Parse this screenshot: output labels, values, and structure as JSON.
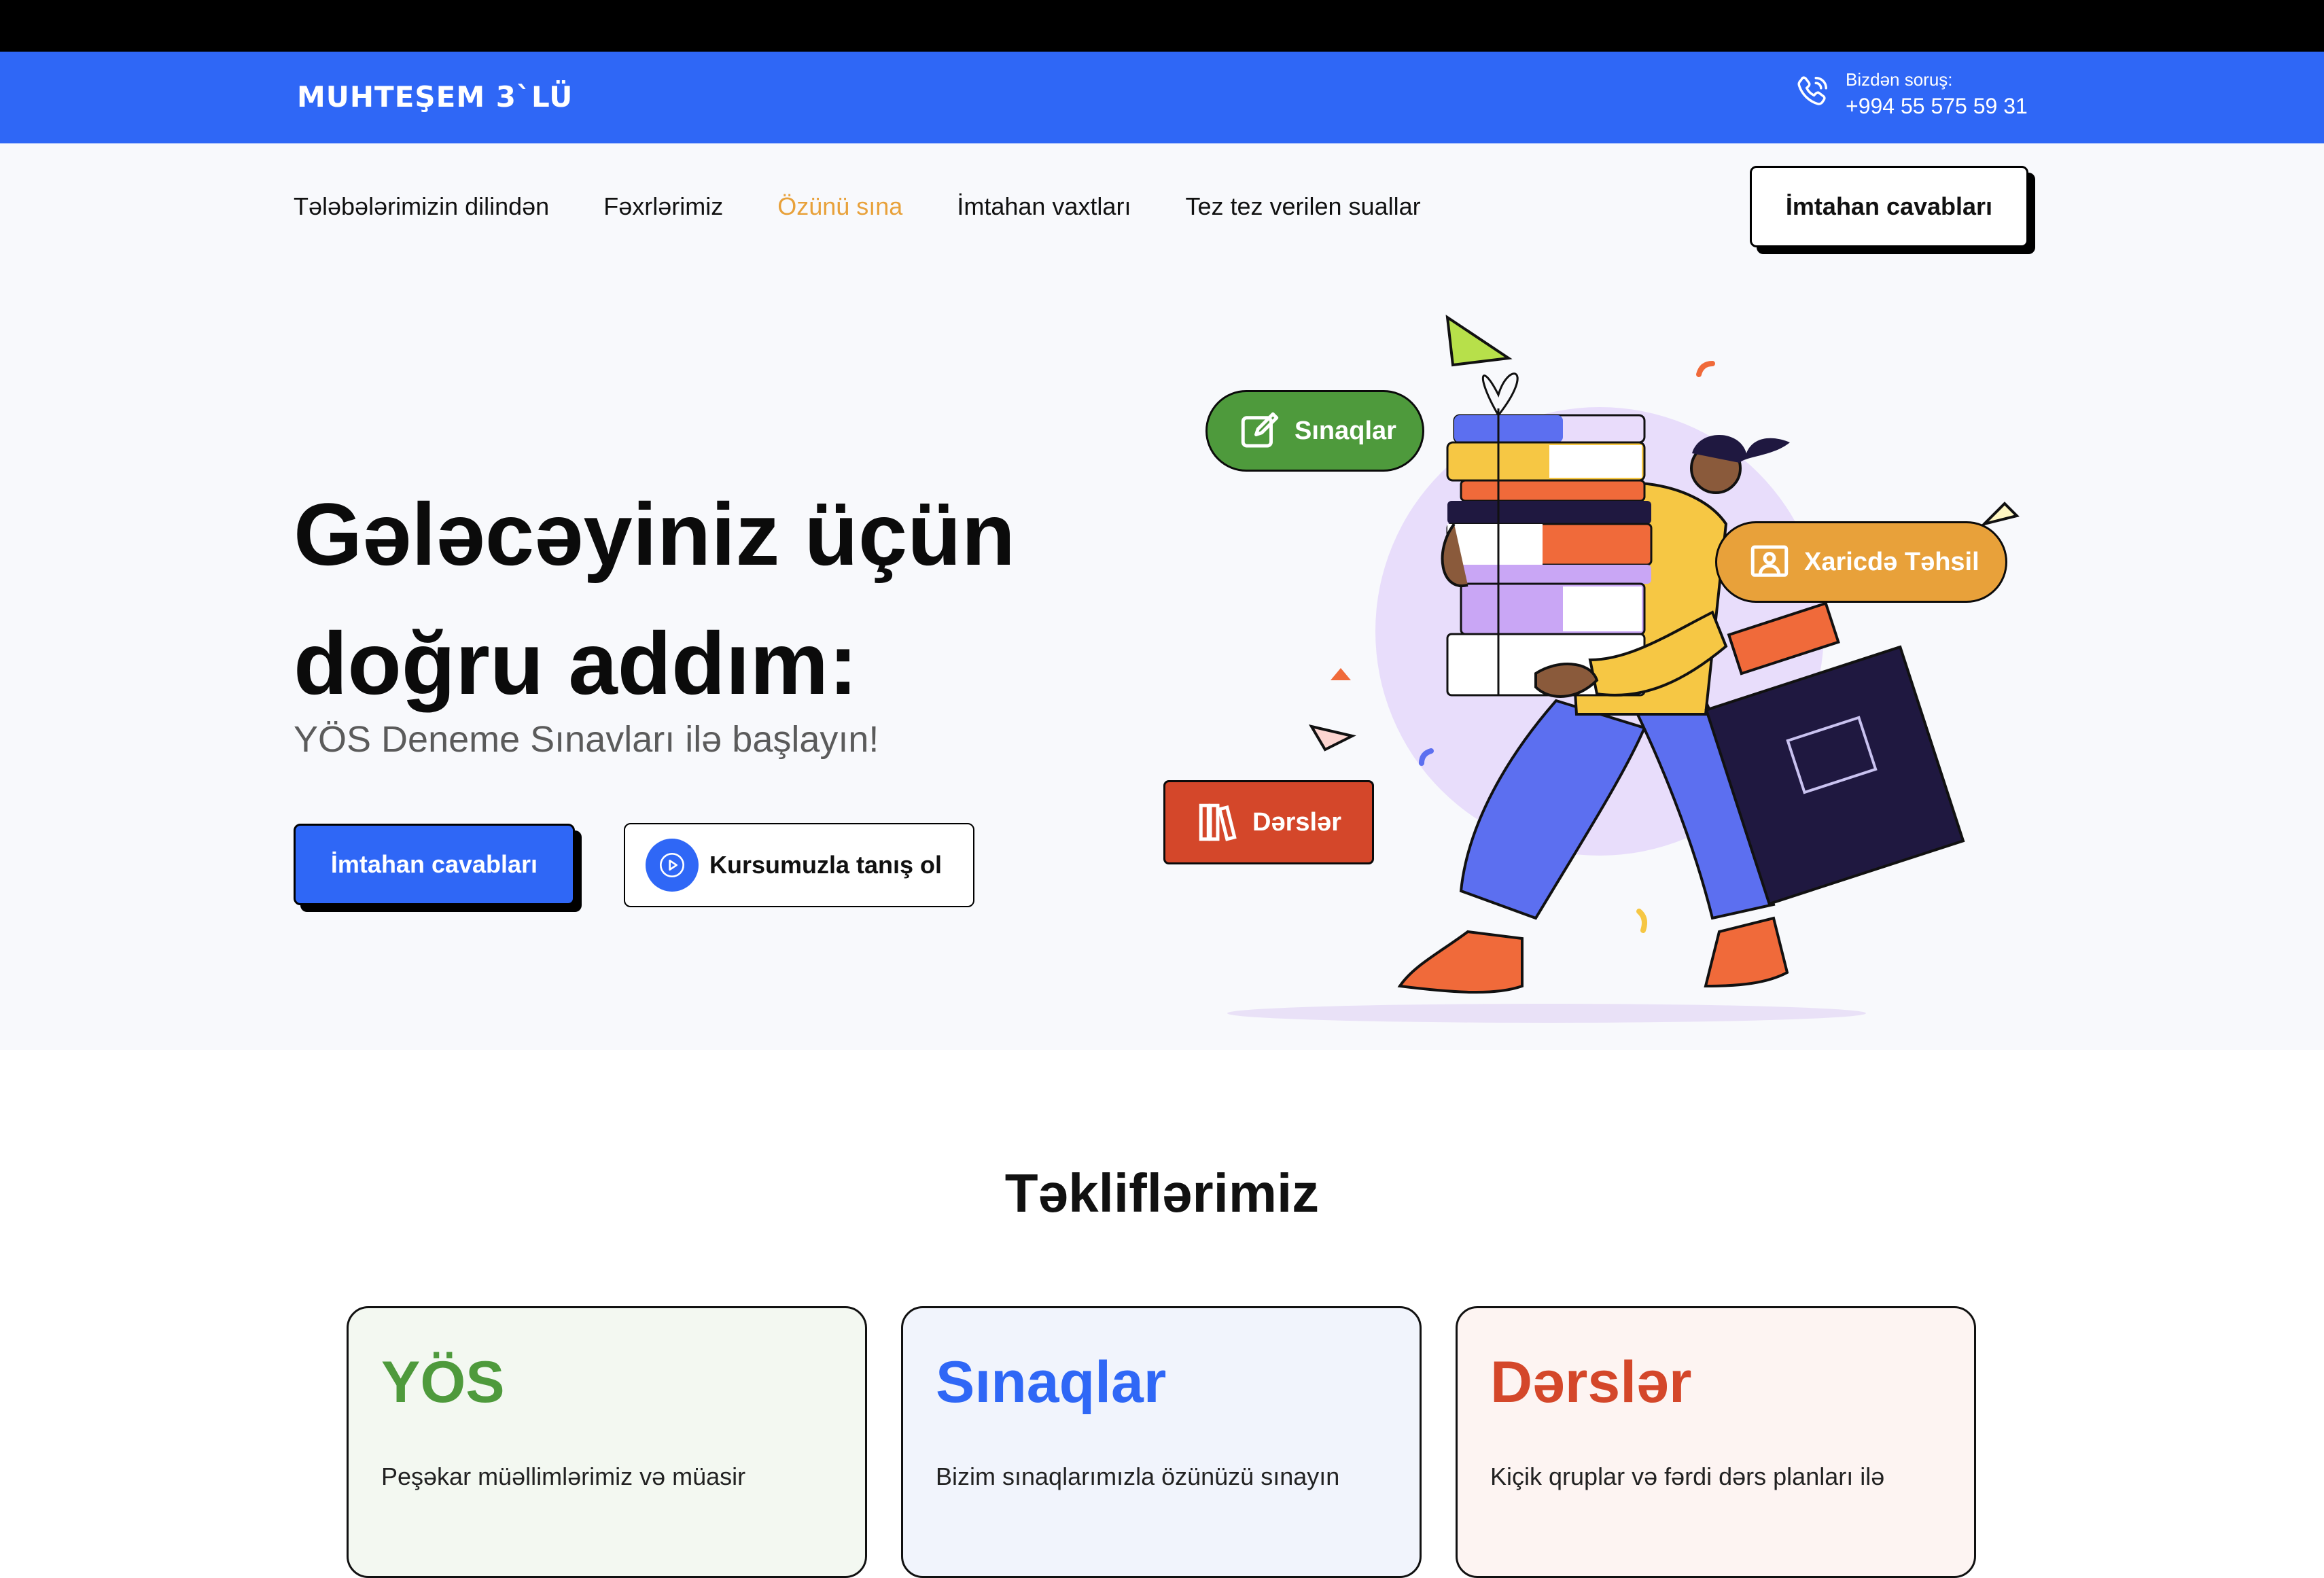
{
  "header": {
    "logo": "MUHTEŞEM 3`LÜ",
    "contact_label": "Bizdən soruş:",
    "contact_number": "+994 55 575 59 31"
  },
  "nav": {
    "items": [
      {
        "label": "Tələbələrimizin dilindən"
      },
      {
        "label": "Fəxrlərimiz"
      },
      {
        "label": "Özünü sına",
        "active": true
      },
      {
        "label": "İmtahan vaxtları"
      },
      {
        "label": "Tez tez verilen suallar"
      }
    ],
    "button": "İmtahan cavabları"
  },
  "hero": {
    "title_line1": "Gələcəyiniz üçün",
    "title_line2": "doğru addım:",
    "subtitle": "YÖS Deneme Sınavları ilə başlayın!",
    "cta_primary": "İmtahan cavabları",
    "cta_secondary": "Kursumuzla tanış ol",
    "badges": {
      "tests": "Sınaqlar",
      "abroad": "Xaricdə Təhsil",
      "lessons": "Dərslər"
    }
  },
  "offers": {
    "title": "Təkliflərimiz",
    "cards": [
      {
        "title": "YÖS",
        "text": "Peşəkar müəllimlərimiz və müasir",
        "color": "#4e9a3c",
        "bg": "#f3f8f1"
      },
      {
        "title": "Sınaqlar",
        "text": "Bizim sınaqlarımızla özünüzü sınayın",
        "color": "#2f67f6",
        "bg": "#f1f4fc"
      },
      {
        "title": "Dərslər",
        "text": "Kiçik qruplar və fərdi dərs planları ilə",
        "color": "#d4472a",
        "bg": "#fdf4f2"
      }
    ]
  },
  "colors": {
    "brand_blue": "#2f67f6",
    "accent_orange": "#e8a13a",
    "green": "#4e9a3c",
    "red": "#d4472a"
  }
}
